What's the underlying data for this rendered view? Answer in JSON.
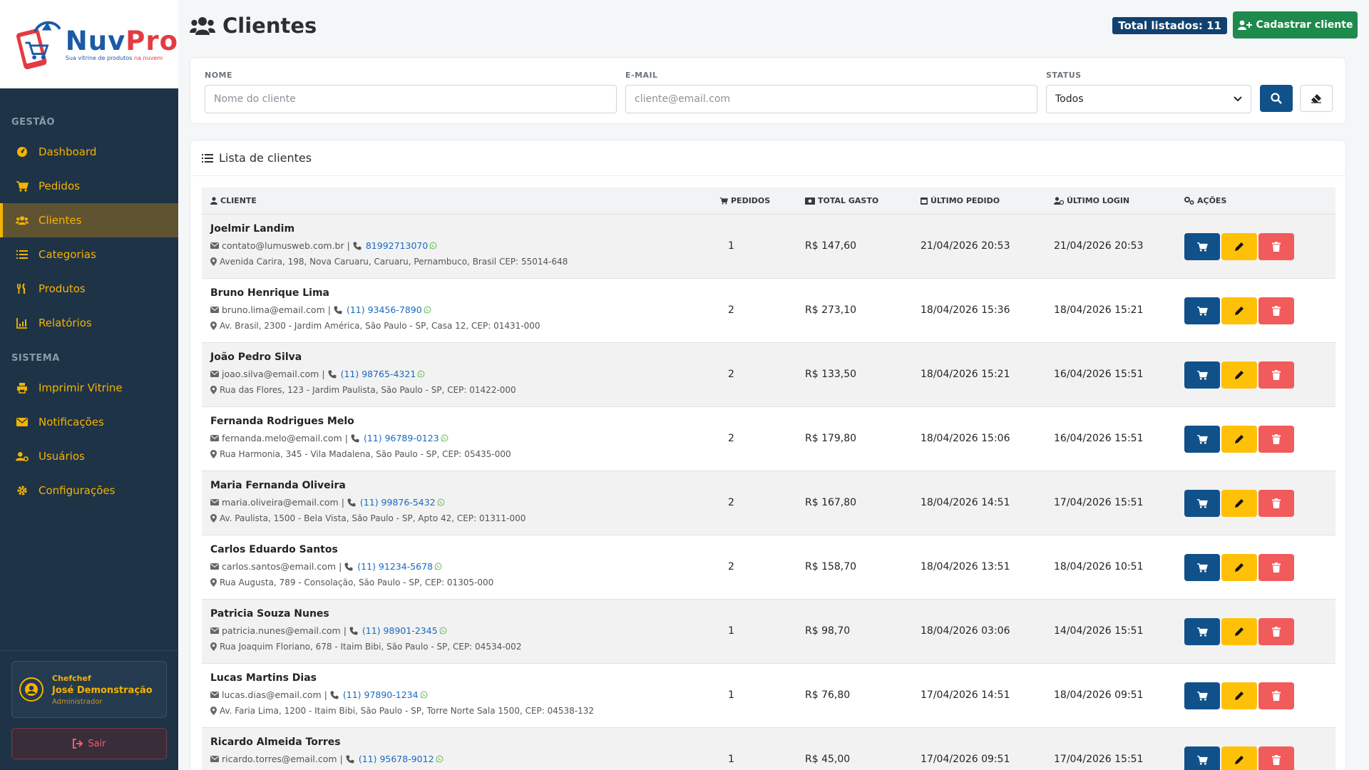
{
  "brand": {
    "name_a": "Nuv",
    "name_b": "Pro",
    "tagline_a": "Sua vitrine de produtos ",
    "tagline_b": "na nuvem"
  },
  "sidebar": {
    "section_gestao": "GESTÃO",
    "section_sistema": "SISTEMA",
    "items": [
      {
        "label": "Dashboard",
        "icon": "dashboard-icon"
      },
      {
        "label": "Pedidos",
        "icon": "cart-icon"
      },
      {
        "label": "Clientes",
        "icon": "users-icon",
        "active": true
      },
      {
        "label": "Categorias",
        "icon": "list-icon"
      },
      {
        "label": "Produtos",
        "icon": "utensils-icon"
      },
      {
        "label": "Relatórios",
        "icon": "chart-icon"
      },
      {
        "label": "Imprimir Vitrine",
        "icon": "print-icon"
      },
      {
        "label": "Notificações",
        "icon": "envelope-icon"
      },
      {
        "label": "Usuários",
        "icon": "user-cog-icon"
      },
      {
        "label": "Configurações",
        "icon": "gear-icon"
      }
    ],
    "user": {
      "company": "Chefchef",
      "name": "José Demonstração",
      "role": "Administrador"
    },
    "logout_label": "Sair"
  },
  "header": {
    "title": "Clientes",
    "total_badge": "Total listados: 11",
    "new_button": "Cadastrar cliente"
  },
  "filters": {
    "name_label": "NOME",
    "name_placeholder": "Nome do cliente",
    "email_label": "E-MAIL",
    "email_placeholder": "cliente@email.com",
    "status_label": "STATUS",
    "status_value": "Todos"
  },
  "list": {
    "title": "Lista de clientes",
    "columns": {
      "cliente": "CLIENTE",
      "pedidos": "PEDIDOS",
      "total": "TOTAL GASTO",
      "ultimo_pedido": "ÚLTIMO PEDIDO",
      "ultimo_login": "ÚLTIMO LOGIN",
      "acoes": "AÇÕES"
    },
    "rows": [
      {
        "name": "Joelmir Landim",
        "email": "contato@lumusweb.com.br",
        "phone": "81992713070",
        "address": "Avenida Carira, 198, Nova Caruaru, Caruaru, Pernambuco, Brasil CEP: 55014-648",
        "orders": "1",
        "total": "R$ 147,60",
        "last_order": "21/04/2026 20:53",
        "last_login": "21/04/2026 20:53"
      },
      {
        "name": "Bruno Henrique Lima",
        "email": "bruno.lima@email.com",
        "phone": "(11) 93456-7890",
        "address": "Av. Brasil, 2300 - Jardim América, São Paulo - SP, Casa 12, CEP: 01431-000",
        "orders": "2",
        "total": "R$ 273,10",
        "last_order": "18/04/2026 15:36",
        "last_login": "18/04/2026 15:21"
      },
      {
        "name": "João Pedro Silva",
        "email": "joao.silva@email.com",
        "phone": "(11) 98765-4321",
        "address": "Rua das Flores, 123 - Jardim Paulista, São Paulo - SP, CEP: 01422-000",
        "orders": "2",
        "total": "R$ 133,50",
        "last_order": "18/04/2026 15:21",
        "last_login": "16/04/2026 15:51"
      },
      {
        "name": "Fernanda Rodrigues Melo",
        "email": "fernanda.melo@email.com",
        "phone": "(11) 96789-0123",
        "address": "Rua Harmonia, 345 - Vila Madalena, São Paulo - SP, CEP: 05435-000",
        "orders": "2",
        "total": "R$ 179,80",
        "last_order": "18/04/2026 15:06",
        "last_login": "16/04/2026 15:51"
      },
      {
        "name": "Maria Fernanda Oliveira",
        "email": "maria.oliveira@email.com",
        "phone": "(11) 99876-5432",
        "address": "Av. Paulista, 1500 - Bela Vista, São Paulo - SP, Apto 42, CEP: 01311-000",
        "orders": "2",
        "total": "R$ 167,80",
        "last_order": "18/04/2026 14:51",
        "last_login": "17/04/2026 15:51"
      },
      {
        "name": "Carlos Eduardo Santos",
        "email": "carlos.santos@email.com",
        "phone": "(11) 91234-5678",
        "address": "Rua Augusta, 789 - Consolação, São Paulo - SP, CEP: 01305-000",
        "orders": "2",
        "total": "R$ 158,70",
        "last_order": "18/04/2026 13:51",
        "last_login": "18/04/2026 10:51"
      },
      {
        "name": "Patricia Souza Nunes",
        "email": "patricia.nunes@email.com",
        "phone": "(11) 98901-2345",
        "address": "Rua Joaquim Floriano, 678 - Itaim Bibi, São Paulo - SP, CEP: 04534-002",
        "orders": "1",
        "total": "R$ 98,70",
        "last_order": "18/04/2026 03:06",
        "last_login": "14/04/2026 15:51"
      },
      {
        "name": "Lucas Martins Dias",
        "email": "lucas.dias@email.com",
        "phone": "(11) 97890-1234",
        "address": "Av. Faria Lima, 1200 - Itaim Bibi, São Paulo - SP, Torre Norte Sala 1500, CEP: 04538-132",
        "orders": "1",
        "total": "R$ 76,80",
        "last_order": "17/04/2026 14:51",
        "last_login": "18/04/2026 09:51"
      },
      {
        "name": "Ricardo Almeida Torres",
        "email": "ricardo.torres@email.com",
        "phone": "(11) 95678-9012",
        "address": "",
        "orders": "1",
        "total": "R$ 45,00",
        "last_order": "17/04/2026 09:51",
        "last_login": "17/04/2026 15:51"
      }
    ]
  },
  "colors": {
    "sidebar_bg": "#1e3346",
    "accent": "#f5b301",
    "primary": "#10518a",
    "success": "#1e8a4c",
    "danger": "#f15b5b",
    "warning": "#ffc107"
  }
}
